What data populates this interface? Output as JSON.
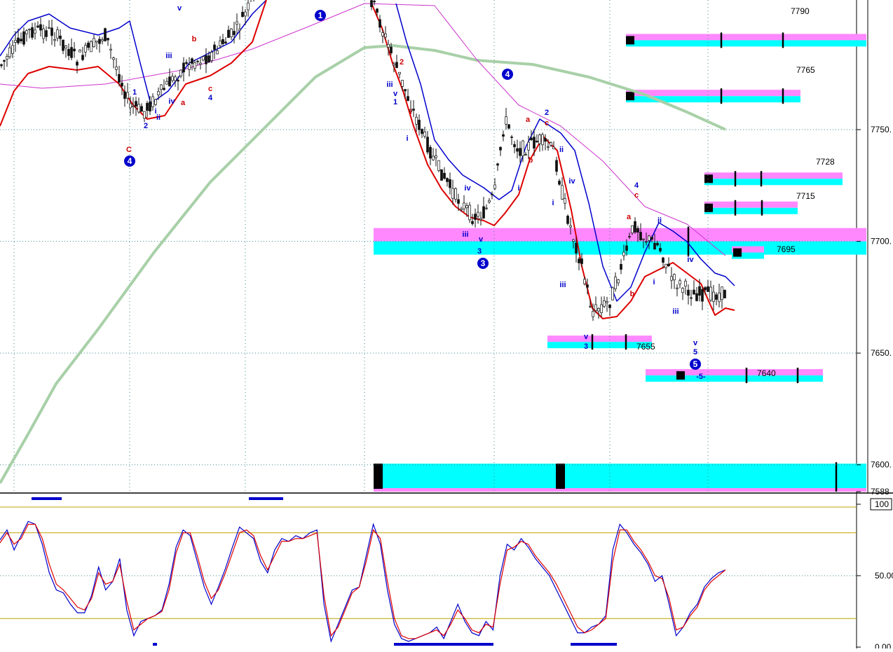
{
  "chart_data": [
    {
      "type": "candlestick",
      "panel": "price",
      "title": "",
      "ylim": [
        7588,
        7808
      ],
      "y_ticks": [
        {
          "value": 7750,
          "label": "7750."
        },
        {
          "value": 7700,
          "label": "7700."
        },
        {
          "value": 7650,
          "label": "7650."
        },
        {
          "value": 7600,
          "label": "7600."
        },
        {
          "value": 7588,
          "label": "7588"
        }
      ],
      "grid": true,
      "target_zones": [
        {
          "label": "7790",
          "value": 7790
        },
        {
          "label": "7765",
          "value": 7765
        },
        {
          "label": "7728",
          "value": 7728
        },
        {
          "label": "7715",
          "value": 7715
        },
        {
          "label": "7700",
          "value": 7700
        },
        {
          "label": "7695",
          "value": 7695
        },
        {
          "label": "7655",
          "value": 7655
        },
        {
          "label": "7640",
          "value": 7640
        },
        {
          "label": "7600",
          "value": 7600
        }
      ],
      "wave_labels": [
        {
          "text": "1",
          "color": "#0000cc",
          "style": "circle"
        },
        {
          "text": "4",
          "color": "#0000cc",
          "style": "circle"
        },
        {
          "text": "3",
          "color": "#0000cc",
          "style": "circle"
        },
        {
          "text": "4",
          "color": "#0000cc",
          "style": "circle"
        },
        {
          "text": "5",
          "color": "#0000cc",
          "style": "circle"
        },
        {
          "text": "C",
          "color": "#cc0000"
        },
        {
          "text": "1",
          "color": "#0000cc"
        },
        {
          "text": "2",
          "color": "#0000cc"
        },
        {
          "text": "i",
          "color": "#0000cc"
        },
        {
          "text": "ii",
          "color": "#0000cc"
        },
        {
          "text": "iii",
          "color": "#0000cc"
        },
        {
          "text": "iv",
          "color": "#0000cc"
        },
        {
          "text": "v",
          "color": "#0000cc"
        },
        {
          "text": "a",
          "color": "#cc0000"
        },
        {
          "text": "b",
          "color": "#cc0000"
        },
        {
          "text": "c",
          "color": "#cc0000"
        },
        {
          "text": "4",
          "color": "#0000cc"
        },
        {
          "text": "iii",
          "color": "#0000cc"
        },
        {
          "text": "v",
          "color": "#0000cc"
        },
        {
          "text": "1",
          "color": "#0000cc"
        },
        {
          "text": "2",
          "color": "#cc0000"
        },
        {
          "text": "i",
          "color": "#cc0000"
        },
        {
          "text": "i",
          "color": "#0000cc"
        },
        {
          "text": "iii",
          "color": "#0000cc"
        },
        {
          "text": "iv",
          "color": "#0000cc"
        },
        {
          "text": "v",
          "color": "#0000cc"
        },
        {
          "text": "3",
          "color": "#0000cc"
        },
        {
          "text": "a",
          "color": "#cc0000"
        },
        {
          "text": "2",
          "color": "#0000cc"
        },
        {
          "text": "c",
          "color": "#cc0000"
        },
        {
          "text": "b",
          "color": "#cc0000"
        },
        {
          "text": "i",
          "color": "#0000cc"
        },
        {
          "text": "ii",
          "color": "#0000cc"
        },
        {
          "text": "i",
          "color": "#0000cc"
        },
        {
          "text": "iii",
          "color": "#0000cc"
        },
        {
          "text": "iv",
          "color": "#0000cc"
        },
        {
          "text": "v",
          "color": "#0000cc"
        },
        {
          "text": "3",
          "color": "#0000cc"
        },
        {
          "text": "4",
          "color": "#0000cc"
        },
        {
          "text": "c",
          "color": "#cc0000"
        },
        {
          "text": "a",
          "color": "#cc0000"
        },
        {
          "text": "b",
          "color": "#cc0000"
        },
        {
          "text": "ii",
          "color": "#0000cc"
        },
        {
          "text": "i",
          "color": "#0000cc"
        },
        {
          "text": "iv",
          "color": "#0000cc"
        },
        {
          "text": "iii",
          "color": "#0000cc"
        },
        {
          "text": "v",
          "color": "#0000cc"
        },
        {
          "text": "5",
          "color": "#0000cc"
        },
        {
          "text": "-5-",
          "color": "#0000cc"
        }
      ],
      "series": [
        {
          "color": "#111111"
        },
        {
          "color": "#0000cc"
        },
        {
          "color": "#dd0000"
        },
        {
          "color": "#cc33cc"
        },
        {
          "color": "#a8d0a8"
        }
      ],
      "colors": {
        "zone_cyan": "#00ffff",
        "zone_pink": "#ff88ff",
        "grid": "#3a8a8a"
      }
    },
    {
      "type": "line",
      "panel": "stochastic",
      "ylim": [
        0,
        100
      ],
      "y_ticks": [
        {
          "value": 100,
          "label": "100"
        },
        {
          "value": 50,
          "label": "50.00"
        },
        {
          "value": 0,
          "label": "0.00"
        }
      ],
      "levels": [
        80,
        50,
        20
      ],
      "grid": true,
      "series": [
        {
          "color": "#0000cc",
          "values": [
            75,
            82,
            68,
            78,
            88,
            86,
            72,
            52,
            40,
            38,
            30,
            24,
            24,
            36,
            56,
            40,
            46,
            62,
            26,
            8,
            18,
            20,
            22,
            26,
            44,
            70,
            82,
            78,
            60,
            42,
            30,
            42,
            55,
            70,
            84,
            80,
            76,
            60,
            52,
            68,
            76,
            74,
            78,
            76,
            80,
            82,
            30,
            4,
            16,
            28,
            40,
            42,
            64,
            86,
            72,
            40,
            16,
            6,
            4,
            6,
            8,
            10,
            14,
            6,
            18,
            30,
            18,
            10,
            8,
            18,
            12,
            50,
            72,
            68,
            76,
            70,
            62,
            56,
            50,
            40,
            30,
            20,
            10,
            10,
            14,
            16,
            22,
            68,
            86,
            80,
            72,
            66,
            58,
            46,
            50,
            30,
            8,
            14,
            24,
            30,
            42,
            48,
            52,
            54
          ]
        },
        {
          "color": "#dd0000",
          "values": [
            73,
            80,
            72,
            76,
            86,
            86,
            76,
            58,
            44,
            40,
            34,
            28,
            26,
            34,
            52,
            44,
            46,
            58,
            32,
            12,
            16,
            20,
            22,
            25,
            40,
            66,
            80,
            80,
            64,
            46,
            34,
            40,
            52,
            66,
            80,
            82,
            78,
            64,
            54,
            64,
            74,
            74,
            76,
            76,
            78,
            80,
            36,
            8,
            14,
            26,
            38,
            42,
            60,
            82,
            76,
            46,
            20,
            8,
            6,
            6,
            8,
            10,
            12,
            8,
            16,
            26,
            20,
            12,
            10,
            16,
            14,
            44,
            68,
            70,
            74,
            72,
            64,
            58,
            52,
            44,
            34,
            24,
            14,
            10,
            12,
            16,
            20,
            60,
            82,
            82,
            74,
            68,
            60,
            50,
            48,
            34,
            12,
            14,
            22,
            28,
            40,
            46,
            50,
            54
          ]
        }
      ],
      "colors": {
        "levels": "#c0a000"
      }
    }
  ]
}
